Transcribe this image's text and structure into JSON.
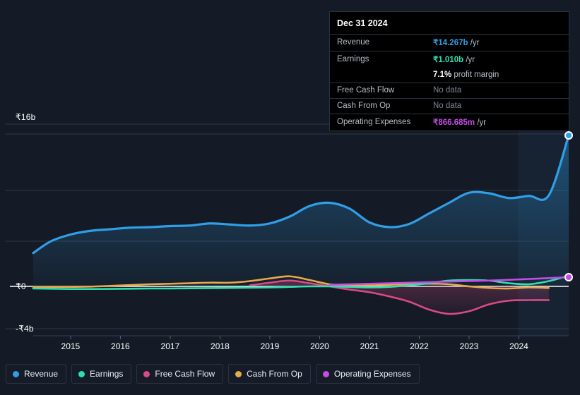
{
  "tooltip": {
    "title": "Dec 31 2024",
    "rows": [
      {
        "label": "Revenue",
        "value": "₹14.267b",
        "unit": "/yr",
        "color": "#2f9fe8",
        "nodata": false
      },
      {
        "label": "Earnings",
        "value": "₹1.010b",
        "unit": "/yr",
        "color": "#2ee0b0",
        "nodata": false
      },
      {
        "label": "",
        "margin_value": "7.1%",
        "margin_text": "profit margin"
      },
      {
        "label": "Free Cash Flow",
        "value": "No data",
        "unit": "",
        "color": "#7d8694",
        "nodata": true
      },
      {
        "label": "Cash From Op",
        "value": "No data",
        "unit": "",
        "color": "#7d8694",
        "nodata": true
      },
      {
        "label": "Operating Expenses",
        "value": "₹866.685m",
        "unit": "/yr",
        "color": "#c44ce8",
        "nodata": false
      }
    ]
  },
  "legend": {
    "items": [
      {
        "label": "Revenue",
        "color": "#2f9fe8"
      },
      {
        "label": "Earnings",
        "color": "#2ee0b0"
      },
      {
        "label": "Free Cash Flow",
        "color": "#d94a86"
      },
      {
        "label": "Cash From Op",
        "color": "#e8a94c"
      },
      {
        "label": "Operating Expenses",
        "color": "#c44ce8"
      }
    ]
  },
  "axes": {
    "y_labels": [
      "₹16b",
      "₹0",
      "-₹4b"
    ],
    "x_labels": [
      "2015",
      "2016",
      "2017",
      "2018",
      "2019",
      "2020",
      "2021",
      "2022",
      "2023",
      "2024"
    ]
  },
  "chart_data": {
    "type": "area",
    "title": "",
    "xlabel": "",
    "ylabel": "",
    "ylim": [
      -4,
      16
    ],
    "xlim": [
      2014.25,
      2025.0
    ],
    "grid": true,
    "legend_position": "bottom",
    "currency": "INR",
    "units": "billions",
    "forecast_start": 2023.98,
    "x": [
      2014.25,
      2014.6,
      2015.0,
      2015.4,
      2015.8,
      2016.2,
      2016.6,
      2017.0,
      2017.4,
      2017.8,
      2018.2,
      2018.6,
      2019.0,
      2019.4,
      2019.8,
      2020.2,
      2020.6,
      2021.0,
      2021.4,
      2021.8,
      2022.2,
      2022.6,
      2023.0,
      2023.4,
      2023.8,
      2024.2,
      2024.6,
      2025.0
    ],
    "series": [
      {
        "name": "Revenue",
        "color": "#2f9fe8",
        "values": [
          3.15,
          4.25,
          4.9,
          5.25,
          5.4,
          5.55,
          5.6,
          5.7,
          5.75,
          5.95,
          5.85,
          5.75,
          5.95,
          6.6,
          7.6,
          7.9,
          7.35,
          6.05,
          5.6,
          5.9,
          6.9,
          7.9,
          8.85,
          8.8,
          8.35,
          8.55,
          8.6,
          14.267
        ],
        "end_marker": true,
        "end_value": 14.267
      },
      {
        "name": "Earnings",
        "color": "#2ee0b0",
        "values": [
          -0.2,
          -0.22,
          -0.25,
          -0.25,
          -0.24,
          -0.22,
          -0.2,
          -0.2,
          -0.18,
          -0.16,
          -0.15,
          -0.12,
          -0.1,
          -0.05,
          0.0,
          0.0,
          -0.05,
          -0.1,
          -0.05,
          0.1,
          0.3,
          0.55,
          0.6,
          0.55,
          0.3,
          0.2,
          0.5,
          1.01
        ],
        "end_marker": false,
        "end_value": 1.01
      },
      {
        "name": "Free Cash Flow",
        "color": "#d94a86",
        "values": [
          null,
          null,
          null,
          null,
          null,
          null,
          null,
          null,
          null,
          null,
          null,
          0.1,
          0.35,
          0.55,
          0.3,
          0.0,
          -0.3,
          -0.55,
          -0.95,
          -1.45,
          -2.2,
          -2.6,
          -2.35,
          -1.7,
          -1.35,
          -1.3,
          -1.3,
          null
        ],
        "end_marker": false,
        "end_value": null
      },
      {
        "name": "Cash From Op",
        "color": "#e8a94c",
        "values": [
          -0.05,
          -0.05,
          -0.05,
          -0.02,
          0.05,
          0.12,
          0.2,
          0.25,
          0.3,
          0.35,
          0.35,
          0.5,
          0.75,
          0.95,
          0.6,
          0.2,
          0.1,
          0.1,
          0.15,
          0.2,
          0.25,
          0.2,
          0.0,
          -0.15,
          -0.2,
          -0.1,
          -0.15,
          null
        ],
        "end_marker": false,
        "end_value": null
      },
      {
        "name": "Operating Expenses",
        "color": "#c44ce8",
        "values": [
          null,
          null,
          null,
          null,
          null,
          null,
          null,
          null,
          null,
          null,
          null,
          null,
          null,
          null,
          null,
          0.15,
          0.2,
          0.25,
          0.3,
          0.35,
          0.4,
          0.45,
          0.5,
          0.55,
          0.62,
          0.7,
          0.78,
          0.866685
        ],
        "end_marker": true,
        "end_value": 0.866685
      }
    ],
    "gridlines_y": [
      16.0,
      15.3,
      11.3,
      7.7,
      0.0,
      -4.0
    ]
  }
}
